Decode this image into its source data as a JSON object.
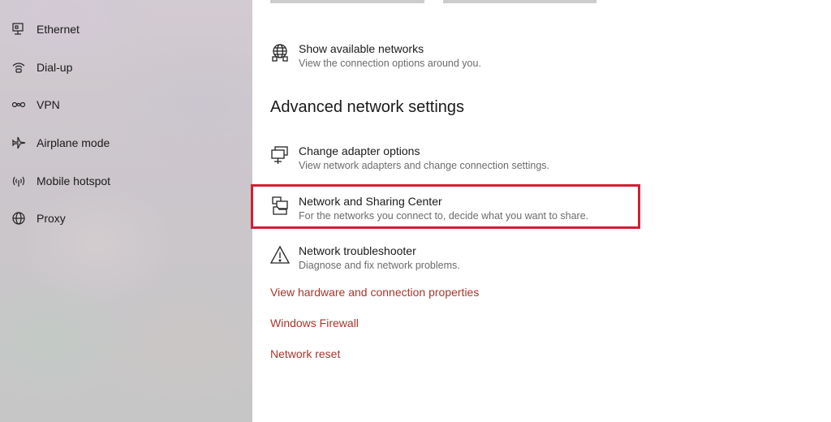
{
  "sidebar": {
    "items": [
      {
        "label": "Ethernet",
        "icon": "ethernet-icon"
      },
      {
        "label": "Dial-up",
        "icon": "dial-up-icon"
      },
      {
        "label": "VPN",
        "icon": "vpn-icon"
      },
      {
        "label": "Airplane mode",
        "icon": "airplane-icon"
      },
      {
        "label": "Mobile hotspot",
        "icon": "hotspot-icon"
      },
      {
        "label": "Proxy",
        "icon": "globe-icon"
      }
    ]
  },
  "main": {
    "show_networks": {
      "title": "Show available networks",
      "desc": "View the connection options around you.",
      "icon": "globe-network-icon"
    },
    "advanced_title": "Advanced network settings",
    "options": [
      {
        "title": "Change adapter options",
        "desc": "View network adapters and change connection settings.",
        "icon": "monitor-adapter-icon"
      },
      {
        "title": "Network and Sharing Center",
        "desc": "For the networks you connect to, decide what you want to share.",
        "icon": "sharing-center-icon"
      },
      {
        "title": "Network troubleshooter",
        "desc": "Diagnose and fix network problems.",
        "icon": "warning-icon"
      }
    ],
    "links": [
      {
        "label": "View hardware and connection properties"
      },
      {
        "label": "Windows Firewall"
      },
      {
        "label": "Network reset"
      }
    ]
  },
  "colors": {
    "link": "#a8352b",
    "highlight": "#d21f35",
    "text": "#1a1a1a",
    "secondary_text": "#6b6b6b"
  }
}
